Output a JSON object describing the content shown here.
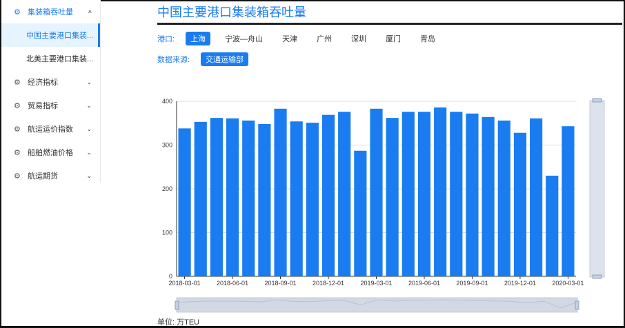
{
  "sidebar": {
    "group": {
      "label": "集装箱吞吐量",
      "children": [
        "中国主要港口集装...",
        "北美主要港口集装..."
      ]
    },
    "items": [
      "经济指标",
      "贸易指标",
      "航运运价指数",
      "船舶燃油价格",
      "航运期货"
    ]
  },
  "page_title": "中国主要港口集装箱吞吐量",
  "port_filter": {
    "label": "港口:",
    "options": [
      "上海",
      "宁波—舟山",
      "天津",
      "广州",
      "深圳",
      "厦门",
      "青岛"
    ],
    "selected": "上海"
  },
  "source_filter": {
    "label": "数据来源:",
    "options": [
      "交通运输部"
    ],
    "selected": "交通运输部"
  },
  "unit_label": "单位: 万TEU",
  "colors": {
    "accent": "#1a7cf0",
    "bar": "#1a7cf0"
  },
  "chart_data": {
    "type": "bar",
    "categories": [
      "2018-03-01",
      "2018-04-01",
      "2018-05-01",
      "2018-06-01",
      "2018-07-01",
      "2018-08-01",
      "2018-09-01",
      "2018-10-01",
      "2018-11-01",
      "2018-12-01",
      "2019-01-01",
      "2019-02-01",
      "2019-03-01",
      "2019-04-01",
      "2019-05-01",
      "2019-06-01",
      "2019-07-01",
      "2019-08-01",
      "2019-09-01",
      "2019-10-01",
      "2019-11-01",
      "2019-12-01",
      "2020-01-01",
      "2020-02-01",
      "2020-03-01"
    ],
    "values": [
      338,
      353,
      362,
      361,
      356,
      348,
      383,
      354,
      351,
      369,
      376,
      287,
      383,
      362,
      376,
      376,
      386,
      376,
      372,
      364,
      356,
      328,
      361,
      230,
      343
    ],
    "xticks": [
      "2018-03-01",
      "2018-06-01",
      "2018-09-01",
      "2018-12-01",
      "2019-03-01",
      "2019-06-01",
      "2019-09-01",
      "2019-12-01",
      "2020-03-01"
    ],
    "yticks": [
      "0",
      "100",
      "200",
      "300",
      "400"
    ],
    "ylim": [
      0,
      400
    ],
    "grid": true,
    "ylabel": "万TEU"
  }
}
